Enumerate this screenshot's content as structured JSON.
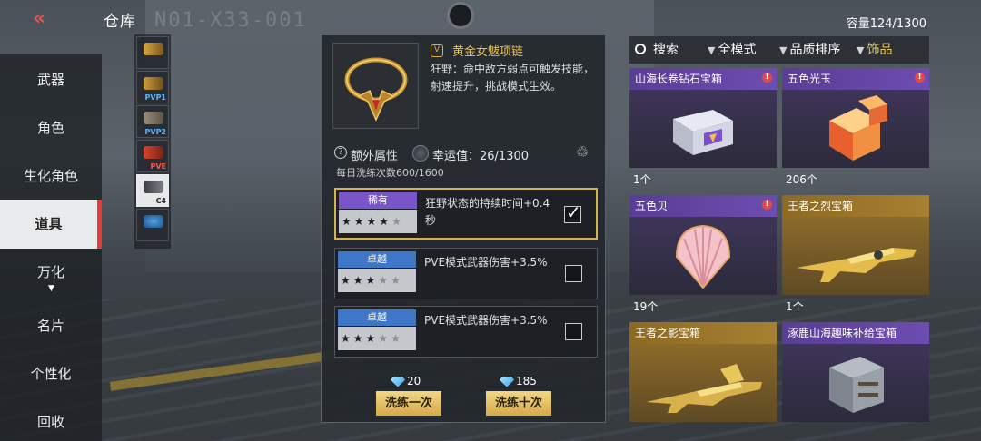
{
  "header": {
    "title": "仓库",
    "capacity": "容量124/1300"
  },
  "left_nav": {
    "items": [
      {
        "label": "武器"
      },
      {
        "label": "角色"
      },
      {
        "label": "生化角色"
      },
      {
        "label": "道具",
        "active": true
      },
      {
        "label": "万化"
      },
      {
        "label": "名片"
      },
      {
        "label": "个性化"
      },
      {
        "label": "回收"
      }
    ]
  },
  "sub_strip": {
    "tags": [
      "PVP1",
      "PVP2",
      "PVE",
      "C4"
    ]
  },
  "detail": {
    "item_name": "黄金女魃项链",
    "item_desc": "狂野：命中敌方弱点可触发技能，射速提升，挑战模式生效。",
    "extra_attr_label": "额外属性",
    "luck_text": "幸运值：26/1300",
    "daily_wash": "每日洗练次数600/1600",
    "attributes": [
      {
        "rarity": "稀有",
        "stars": 4,
        "max_stars": 5,
        "text": "狂野状态的持续时间+0.4秒",
        "checked": true,
        "color": "#7a55c9"
      },
      {
        "rarity": "卓越",
        "stars": 3,
        "max_stars": 5,
        "text": "PVE模式武器伤害+3.5%",
        "checked": false,
        "color": "#3f77c8"
      },
      {
        "rarity": "卓越",
        "stars": 3,
        "max_stars": 5,
        "text": "PVE模式武器伤害+3.5%",
        "checked": false,
        "color": "#3f77c8"
      }
    ],
    "wash_once": {
      "cost": "20",
      "label": "洗练一次"
    },
    "wash_ten": {
      "cost": "185",
      "label": "洗练十次"
    }
  },
  "inventory": {
    "toolbar": {
      "search": "搜索",
      "mode": "全模式",
      "sort": "品质排序",
      "category": "饰品"
    },
    "cards": [
      {
        "name": "山海长卷钻石宝箱",
        "count": "1个",
        "quality": "purple",
        "new": true
      },
      {
        "name": "五色光玉",
        "count": "206个",
        "quality": "purple",
        "new": true
      },
      {
        "name": "五色贝",
        "count": "19个",
        "quality": "purple",
        "new": true
      },
      {
        "name": "王者之烈宝箱",
        "count": "1个",
        "quality": "gold",
        "new": false
      },
      {
        "name": "王者之影宝箱",
        "count": "",
        "quality": "gold",
        "new": false
      },
      {
        "name": "涿鹿山海趣味补给宝箱",
        "count": "",
        "quality": "purple",
        "new": false
      }
    ]
  },
  "colors": {
    "accent_red": "#e23b3b",
    "gold": "#e9c25a",
    "purple": "#7a55c9",
    "blue": "#3f77c8"
  }
}
